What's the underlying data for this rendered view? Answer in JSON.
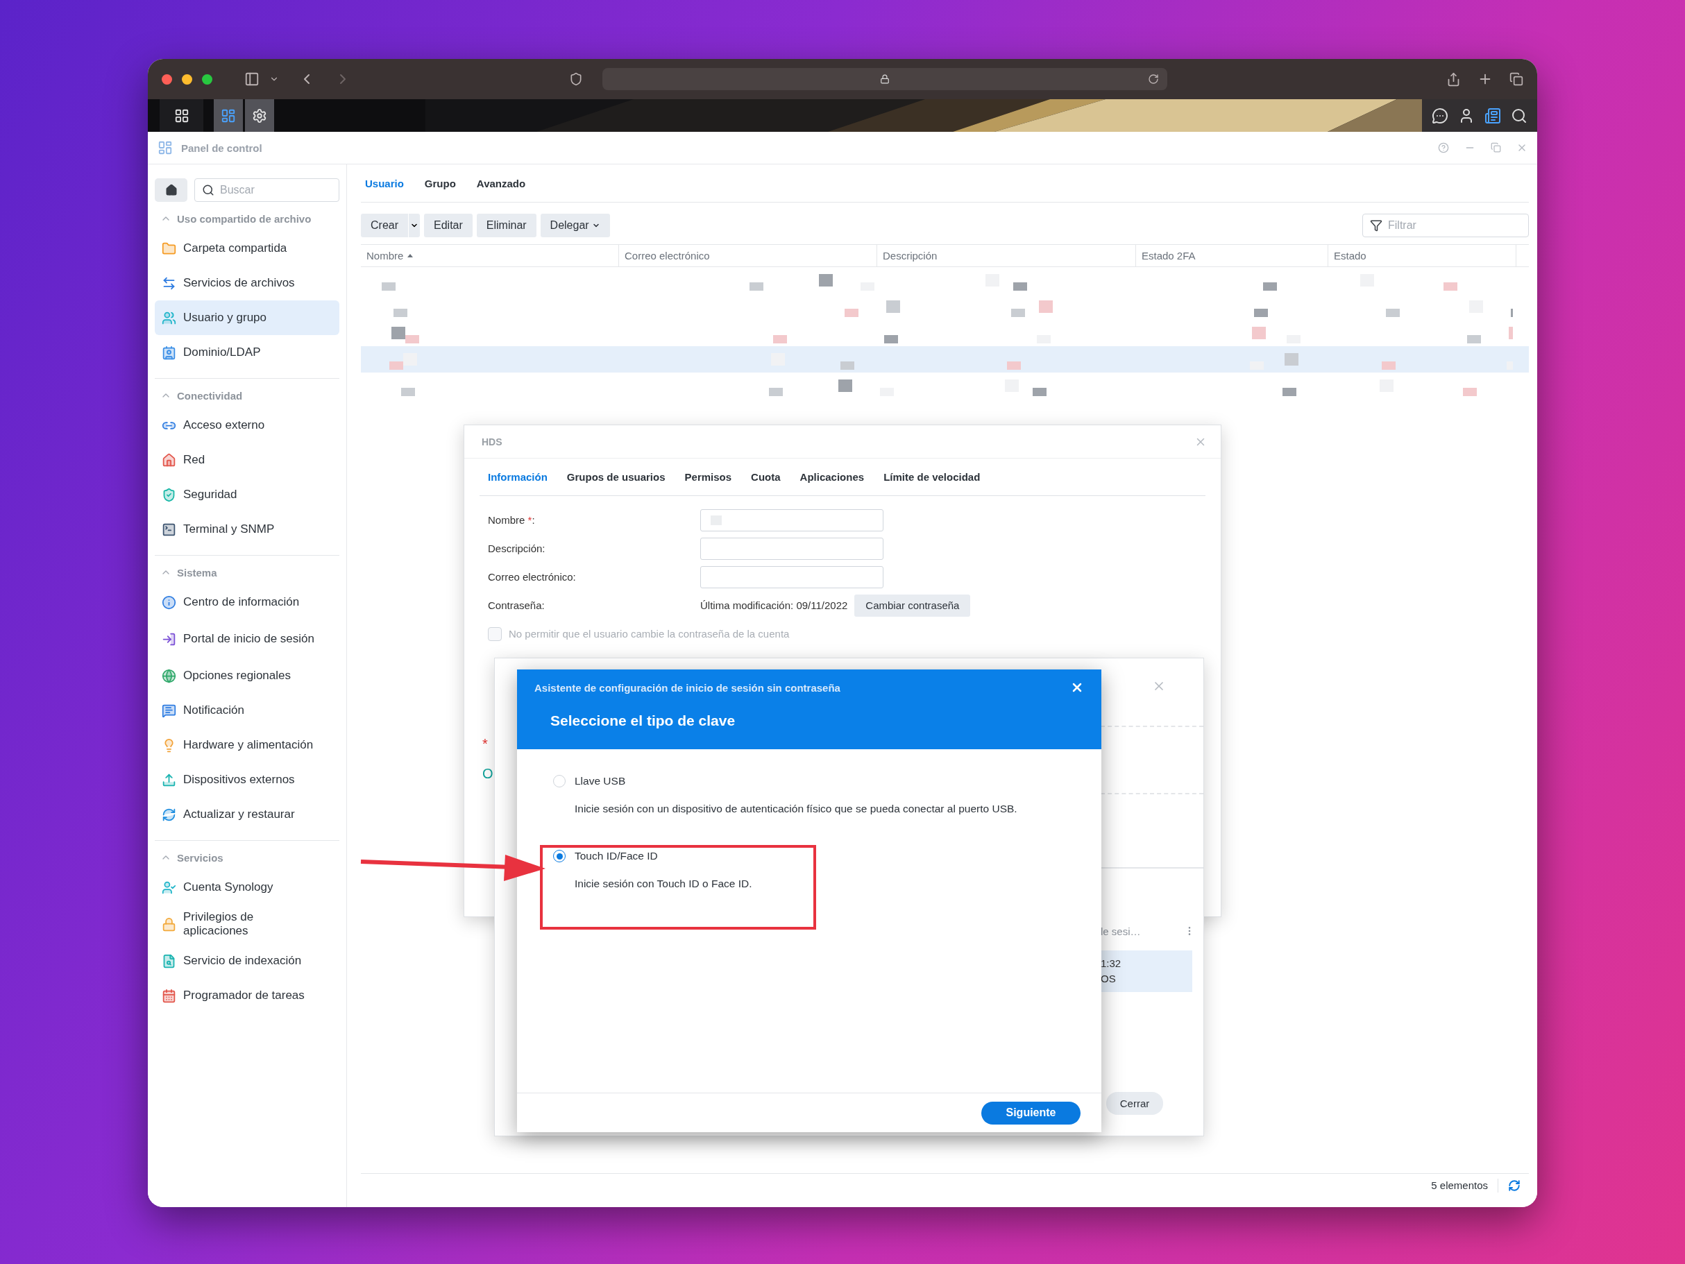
{
  "window": {
    "title": "Panel de control"
  },
  "sidebar": {
    "search": {
      "placeholder": "Buscar"
    },
    "sections": [
      {
        "title": "Uso compartido de archivo",
        "expanded": true,
        "items": [
          {
            "label": "Carpeta compartida",
            "selected": false
          },
          {
            "label": "Servicios de archivos",
            "selected": false
          },
          {
            "label": "Usuario y grupo",
            "selected": true
          },
          {
            "label": "Dominio/LDAP",
            "selected": false
          }
        ]
      },
      {
        "title": "Conectividad",
        "expanded": true,
        "items": [
          {
            "label": "Acceso externo",
            "selected": false
          },
          {
            "label": "Red",
            "selected": false
          },
          {
            "label": "Seguridad",
            "selected": false
          },
          {
            "label": "Terminal y SNMP",
            "selected": false
          }
        ]
      },
      {
        "title": "Sistema",
        "expanded": true,
        "items": [
          {
            "label": "Centro de información",
            "selected": false
          },
          {
            "label": "Portal de inicio de sesión",
            "selected": false
          },
          {
            "label": "Opciones regionales",
            "selected": false
          },
          {
            "label": "Notificación",
            "selected": false
          },
          {
            "label": "Hardware y alimentación",
            "selected": false
          },
          {
            "label": "Dispositivos externos",
            "selected": false
          },
          {
            "label": "Actualizar y restaurar",
            "selected": false
          }
        ]
      },
      {
        "title": "Servicios",
        "expanded": true,
        "items": [
          {
            "label": "Cuenta Synology",
            "selected": false
          },
          {
            "label": "Privilegios de aplicaciones",
            "selected": false
          },
          {
            "label": "Servicio de indexación",
            "selected": false
          },
          {
            "label": "Programador de tareas",
            "selected": false
          }
        ]
      }
    ]
  },
  "tabs": [
    {
      "label": "Usuario",
      "selected": true
    },
    {
      "label": "Grupo",
      "selected": false
    },
    {
      "label": "Avanzado",
      "selected": false
    }
  ],
  "toolbar": {
    "buttons": [
      {
        "label": "Crear",
        "kind": "split"
      },
      {
        "label": "Editar",
        "kind": "plain"
      },
      {
        "label": "Eliminar",
        "kind": "plain"
      },
      {
        "label": "Delegar",
        "kind": "menu"
      }
    ],
    "filter": {
      "placeholder": "Filtrar"
    }
  },
  "table": {
    "columns": [
      {
        "label": "Nombre",
        "sorted": true
      },
      {
        "label": "Correo electrónico",
        "sorted": false
      },
      {
        "label": "Descripción",
        "sorted": false
      },
      {
        "label": "Estado 2FA",
        "sorted": false
      },
      {
        "label": "Estado",
        "sorted": false
      }
    ],
    "rows": [
      {
        "selected": false
      },
      {
        "selected": false
      },
      {
        "selected": false
      },
      {
        "selected": true
      },
      {
        "selected": false
      }
    ]
  },
  "status_bar": {
    "count": "5 elementos"
  },
  "user_dialog": {
    "title": "HDS",
    "tabs": [
      {
        "label": "Información",
        "selected": true
      },
      {
        "label": "Grupos de usuarios",
        "selected": false
      },
      {
        "label": "Permisos",
        "selected": false
      },
      {
        "label": "Cuota",
        "selected": false
      },
      {
        "label": "Aplicaciones",
        "selected": false
      },
      {
        "label": "Límite de velocidad",
        "selected": false
      }
    ],
    "fields": [
      {
        "kind": "input",
        "label": "Nombre",
        "required_mark": "*",
        "suffix": ":"
      },
      {
        "kind": "input",
        "label": "Descripción:"
      },
      {
        "kind": "input",
        "label": "Correo electrónico:"
      },
      {
        "kind": "password",
        "label": "Contraseña:",
        "value": "Última modificación: 09/11/2022",
        "button": "Cambiar contraseña"
      }
    ],
    "checkboxes": [
      {
        "label": "No permitir que el usuario cambie la contraseña de la cuenta",
        "checked": false,
        "disabled": true
      }
    ],
    "margin_texts": [
      {
        "text": "*",
        "kind": "required"
      },
      {
        "text": "O",
        "kind": "link"
      }
    ]
  },
  "login_dialog": {
    "column": "le sesi…",
    "rows": [
      {
        "lines": [
          "1:32",
          "OS"
        ],
        "selected": true
      }
    ],
    "button": "Cerrar"
  },
  "wizard": {
    "title": "Asistente de configuración de inicio de sesión sin contraseña",
    "heading": "Seleccione el tipo de clave",
    "options": [
      {
        "label": "Llave USB",
        "description": "Inicie sesión con un dispositivo de autenticación físico que se pueda conectar al puerto USB.",
        "selected": false
      },
      {
        "label": "Touch ID/Face ID",
        "description": "Inicie sesión con Touch ID o Face ID.",
        "selected": true
      }
    ],
    "button": "Siguiente"
  }
}
